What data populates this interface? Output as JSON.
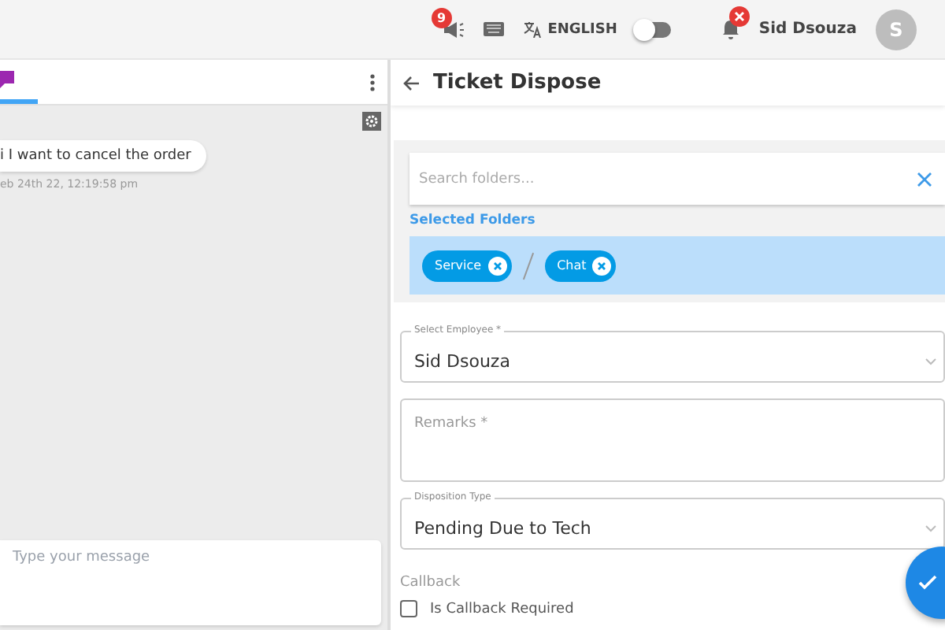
{
  "top_bar": {
    "announcement_count": "9",
    "language": "ENGLISH",
    "toggle_on": false,
    "user_name": "Sid Dsouza",
    "avatar_initial": "S"
  },
  "chat": {
    "tab_selected": true,
    "message": "i I want to cancel the order",
    "timestamp": "eb 24th 22, 12:19:58 pm",
    "composer": {
      "placeholder": "Type your message"
    }
  },
  "ticket": {
    "title": "Ticket Dispose",
    "search": {
      "placeholder": "Search folders..."
    },
    "selected_label": "Selected Folders",
    "folders": [
      {
        "label": "Service"
      },
      {
        "label": "Chat"
      }
    ],
    "employee": {
      "label": "Select Employee *",
      "value": "Sid Dsouza"
    },
    "remarks": {
      "placeholder": "Remarks *"
    },
    "disposition": {
      "label": "Disposition Type",
      "value": "Pending Due to Tech"
    },
    "callback": {
      "label": "Callback",
      "checkbox_label": "Is Callback Required",
      "checked": false
    }
  }
}
